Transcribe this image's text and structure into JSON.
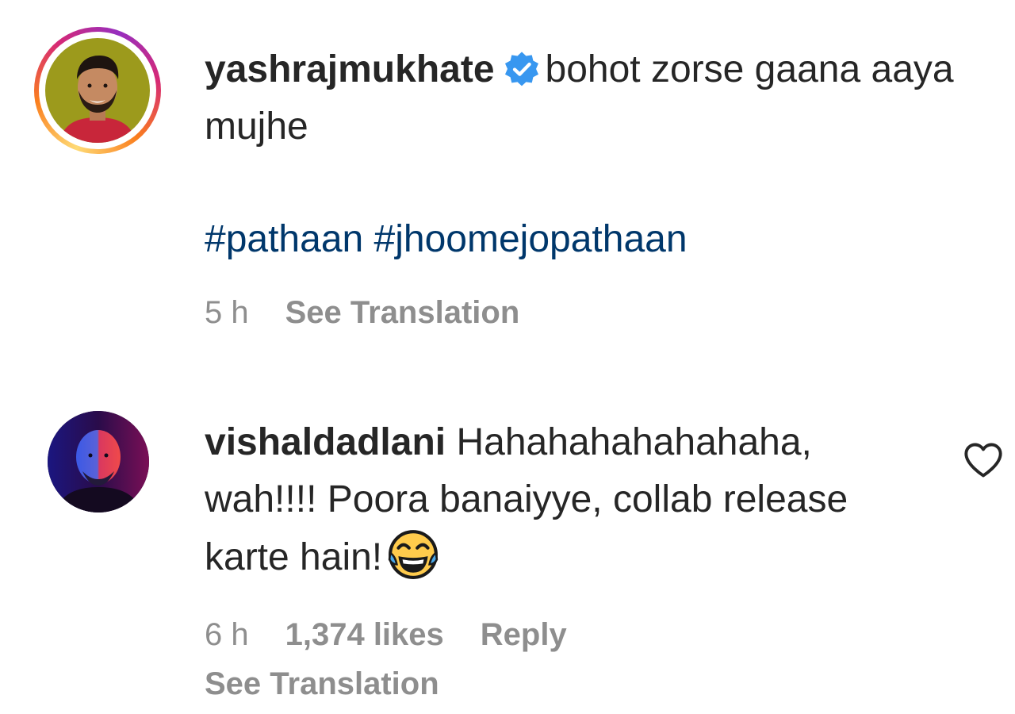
{
  "caption": {
    "avatar_icon": "profile-photo-yashraj",
    "username": "yashrajmukhate",
    "verified_icon": "verified-badge-icon",
    "text": "bohot zorse gaana aaya mujhe",
    "hashtags": [
      "#pathaan",
      "#jhoomejopathaan"
    ],
    "time": "5 h",
    "see_translation": "See Translation"
  },
  "comment": {
    "avatar_icon": "profile-photo-vishal",
    "username": "vishaldadlani",
    "text": "Hahahahahahahaha, wah!!!! Poora banaiyye, collab release karte hain!",
    "emoji_icon": "face-with-tears-of-joy-emoji",
    "time": "6 h",
    "likes": "1,374 likes",
    "reply": "Reply",
    "see_translation": "See Translation",
    "like_icon": "heart-outline-icon"
  },
  "colors": {
    "text": "#262626",
    "secondary": "#8e8e8e",
    "hashtag": "#00376b",
    "verified": "#3897f0"
  }
}
